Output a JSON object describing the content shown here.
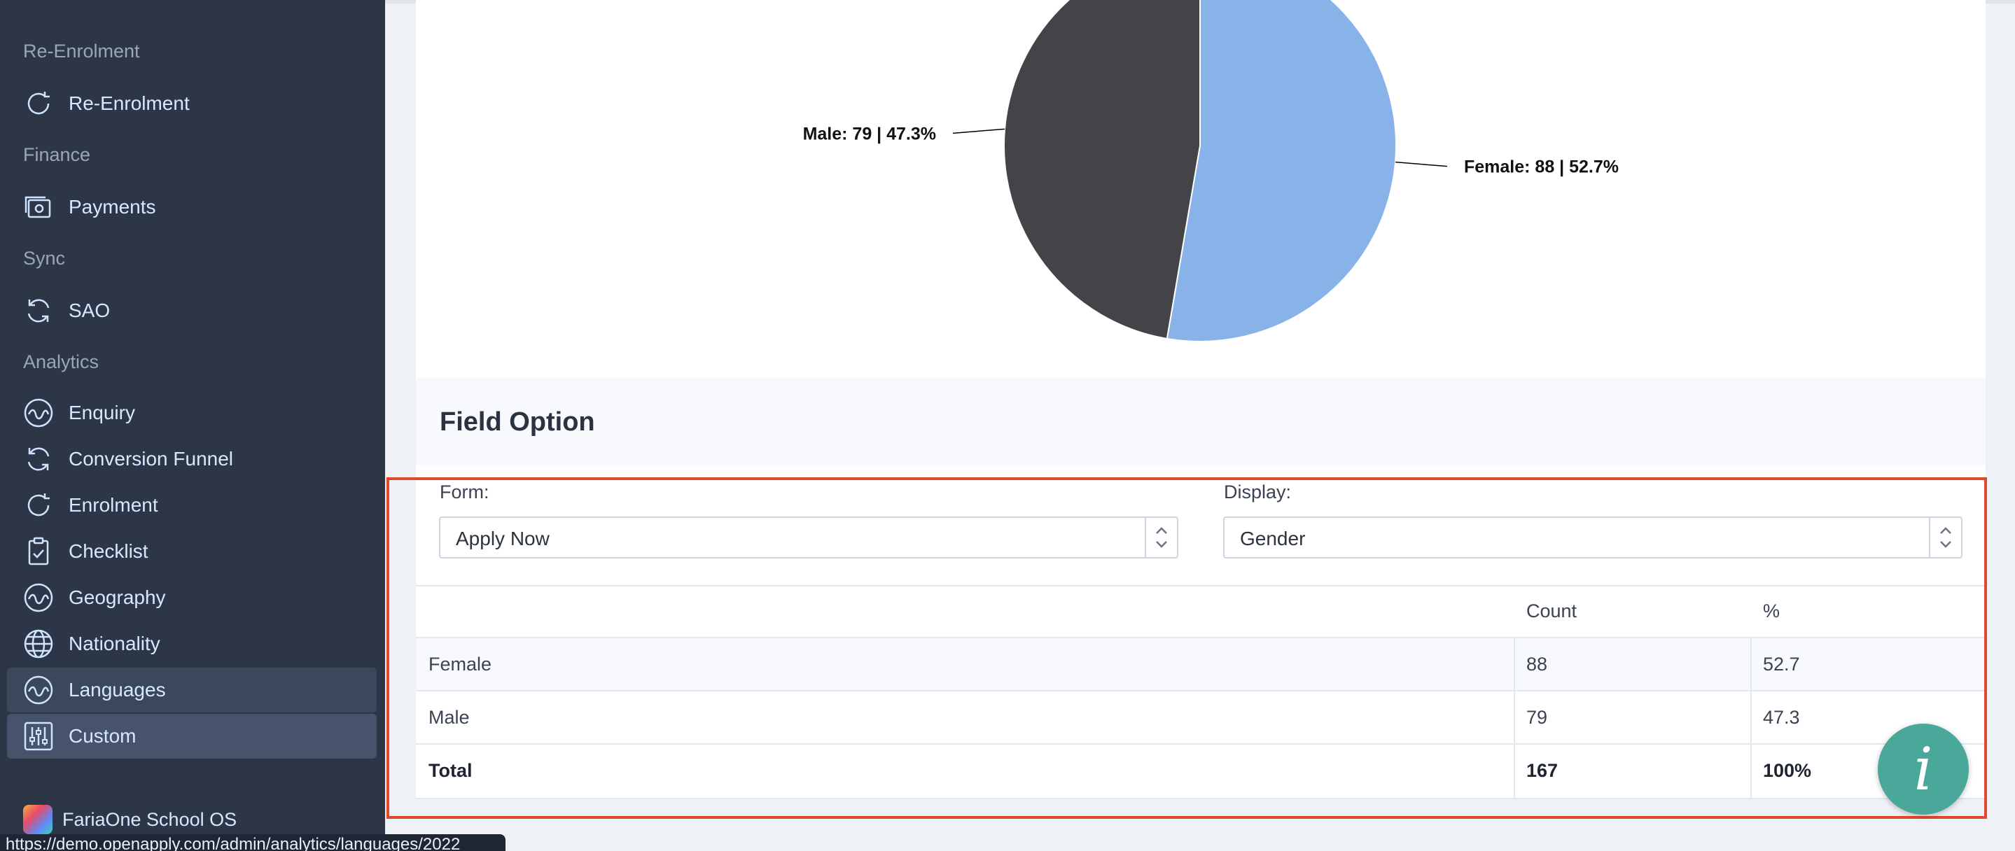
{
  "sidebar": {
    "sections": [
      {
        "label": "Re-Enrolment"
      },
      {
        "label": "Finance"
      },
      {
        "label": "Sync"
      },
      {
        "label": "Analytics"
      }
    ],
    "items": [
      {
        "label": "Re-Enrolment",
        "icon": "refresh-icon"
      },
      {
        "label": "Payments",
        "icon": "payments-icon"
      },
      {
        "label": "SAO",
        "icon": "sync-icon"
      },
      {
        "label": "Enquiry",
        "icon": "wave-icon"
      },
      {
        "label": "Conversion Funnel",
        "icon": "sync-icon"
      },
      {
        "label": "Enrolment",
        "icon": "refresh-icon"
      },
      {
        "label": "Checklist",
        "icon": "clipboard-check-icon"
      },
      {
        "label": "Geography",
        "icon": "wave-icon"
      },
      {
        "label": "Nationality",
        "icon": "globe-icon"
      },
      {
        "label": "Languages",
        "icon": "wave-icon"
      },
      {
        "label": "Custom",
        "icon": "sliders-icon"
      }
    ],
    "brand": "FariaOne School OS"
  },
  "status_url": "https://demo.openapply.com/admin/analytics/languages/2022",
  "chart_data": {
    "type": "pie",
    "slices": [
      {
        "label": "Female: 88 | 52.7%",
        "name": "Female",
        "value": 88,
        "percent": 52.7,
        "color": "#88b3e8"
      },
      {
        "label": "Male: 79 | 47.3%",
        "name": "Male",
        "value": 79,
        "percent": 47.3,
        "color": "#434348"
      }
    ]
  },
  "field_option": {
    "title": "Field Option",
    "form_label": "Form:",
    "form_value": "Apply Now",
    "display_label": "Display:",
    "display_value": "Gender"
  },
  "table": {
    "headers": [
      "",
      "Count",
      "%"
    ],
    "rows": [
      [
        "Female",
        "88",
        "52.7"
      ],
      [
        "Male",
        "79",
        "47.3"
      ]
    ],
    "total": [
      "Total",
      "167",
      "100%"
    ]
  },
  "info_button": "i",
  "colors": {
    "accent_highlight": "#e1492b",
    "sidebar_bg": "#2c3647",
    "info_button": "#4aa89a"
  }
}
